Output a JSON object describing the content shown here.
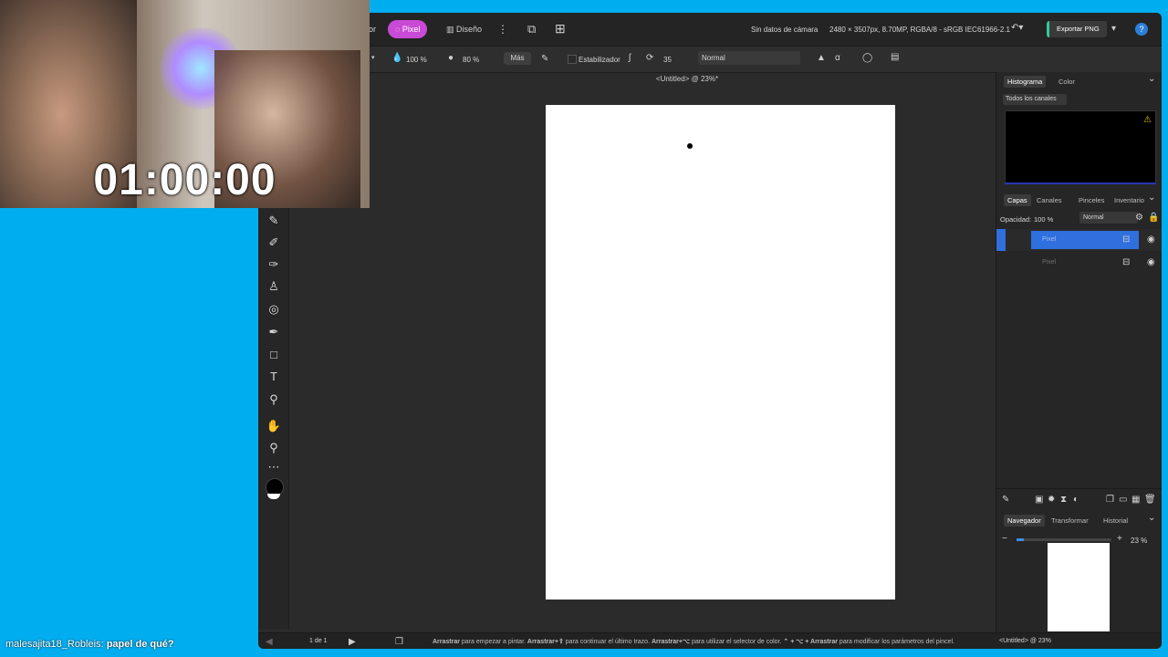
{
  "webcam": {
    "timer": "01:00:00"
  },
  "chat": {
    "user": "malesajita18_Robleis:",
    "message": "papel de qué?"
  },
  "topbar": {
    "persona_partial": "or",
    "pixel_label": "Pixel",
    "design_label": "Diseño",
    "camera_info": "Sin datos de cámara",
    "doc_info": "2480 × 3507px, 8.70MP, RGBA/8 - sRGB IEC61966-2.1",
    "export_label": "Exportar PNG",
    "help_label": "?"
  },
  "context": {
    "opacity": "100 %",
    "flow": "80 %",
    "more": "Más",
    "stabilizer": "Estabilizador",
    "stabilizer_value": "35",
    "blend_mode": "Normal"
  },
  "document": {
    "title": "<Untitled> @ 23%*"
  },
  "panels": {
    "histogram_tab": "Histograma",
    "color_tab": "Color",
    "channels_select": "Todos los canales",
    "layers_tabs": [
      "Capas",
      "Canales",
      "Pinceles",
      "Inventario"
    ],
    "opacity_label": "Opacidad:",
    "opacity_value": "100 %",
    "blend": "Normal",
    "layers": [
      {
        "name": "Pixel"
      },
      {
        "name": "Pixel"
      }
    ],
    "nav_tabs": [
      "Navegador",
      "Transformar",
      "Historial"
    ],
    "zoom": "23 %"
  },
  "bottom": {
    "page": "1 de 1",
    "hint_1": "Arrastrar",
    "hint_2": " para empezar a pintar. ",
    "hint_3": "Arrastrar+⇧",
    "hint_4": " para continuar el último trazo. ",
    "hint_5": "Arrastrar+⌥",
    "hint_6": " para utilizar el selector de color. ",
    "hint_7": "⌃ + ⌥ + Arrastrar",
    "hint_8": " para modificar los parámetros del pincel.",
    "doc_status": "<Untitled> @ 23%"
  },
  "colors": {
    "accent": "#c94ad6",
    "selection": "#2f6fde",
    "background": "#00aef0",
    "export_accent": "#2ecc9a"
  }
}
